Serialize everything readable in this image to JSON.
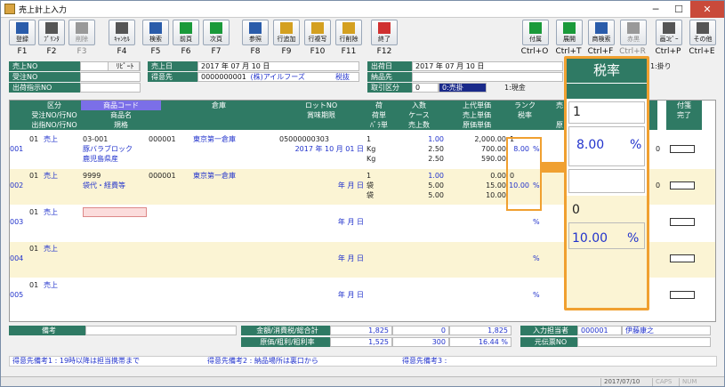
{
  "window": {
    "title": "売上計上入力",
    "min": "─",
    "max": "☐",
    "close": "✕"
  },
  "toolbar": {
    "left": [
      {
        "name": "register",
        "label": "登録",
        "icon": "save-icon",
        "key": "F1",
        "color": "#2a5caa",
        "disabled": false
      },
      {
        "name": "print",
        "label": "ﾌﾟﾘﾝﾀ",
        "icon": "printer-icon",
        "key": "F2",
        "color": "#555",
        "disabled": false
      },
      {
        "name": "delete",
        "label": "削除",
        "icon": "delete-icon",
        "key": "F3",
        "color": "#999",
        "disabled": true
      },
      {
        "name": "cancel",
        "label": "ｷｬﾝｾﾙ",
        "icon": "cancel-icon",
        "key": "F4",
        "color": "#555",
        "disabled": false
      },
      {
        "name": "search",
        "label": "検索",
        "icon": "search-icon",
        "key": "F5",
        "color": "#2a5caa",
        "disabled": false
      },
      {
        "name": "prev",
        "label": "前頁",
        "icon": "arrow-left-icon",
        "key": "F6",
        "color": "#1a9a3a",
        "disabled": false
      },
      {
        "name": "next",
        "label": "次頁",
        "icon": "arrow-right-icon",
        "key": "F7",
        "color": "#1a9a3a",
        "disabled": false
      },
      {
        "name": "reference",
        "label": "参照",
        "icon": "reference-icon",
        "key": "F8",
        "color": "#2a5caa",
        "disabled": false
      },
      {
        "name": "row-add",
        "label": "行追加",
        "icon": "row-add-icon",
        "key": "F9",
        "color": "#d4a020",
        "disabled": false
      },
      {
        "name": "row-copy",
        "label": "行複写",
        "icon": "row-copy-icon",
        "key": "F10",
        "color": "#d4a020",
        "disabled": false
      },
      {
        "name": "row-delete",
        "label": "行削除",
        "icon": "row-delete-icon",
        "key": "F11",
        "color": "#d4a020",
        "disabled": false
      },
      {
        "name": "exit",
        "label": "終了",
        "icon": "exit-icon",
        "key": "F12",
        "color": "#d03030",
        "disabled": false
      }
    ],
    "right": [
      {
        "name": "attach",
        "label": "付属",
        "icon": "attach-icon",
        "key": "Ctrl+O",
        "color": "#1a9a3a",
        "disabled": false
      },
      {
        "name": "expand",
        "label": "展開",
        "icon": "expand-icon",
        "key": "Ctrl+T",
        "color": "#1a9a3a",
        "disabled": false
      },
      {
        "name": "product-search",
        "label": "商検索",
        "icon": "search-icon",
        "key": "Ctrl+F",
        "color": "#2a5caa",
        "disabled": false
      },
      {
        "name": "red-black",
        "label": "赤黒",
        "icon": "red-black-icon",
        "key": "Ctrl+R",
        "color": "#999",
        "disabled": true
      },
      {
        "name": "screen-copy",
        "label": "画ｺﾋﾟｰ",
        "icon": "screen-copy-icon",
        "key": "Ctrl+P",
        "color": "#555",
        "disabled": false
      },
      {
        "name": "other",
        "label": "その他",
        "icon": "tools-icon",
        "key": "Ctrl+E",
        "color": "#555",
        "disabled": false
      }
    ]
  },
  "header": {
    "sales_no_label": "売上NO",
    "sales_no": "",
    "repeat_label": "ﾘﾋﾟｰﾄ",
    "sales_date_label": "売上日",
    "sales_date": "2017 年 07 月 10 日",
    "ship_date_label": "出荷日",
    "ship_date": "2017 年 07 月 10 日",
    "slip_type": "1:掛り",
    "receipt_no_label": "受注NO",
    "receipt_no": "",
    "customer_label": "得意先",
    "customer_code": "0000000001",
    "customer_name": "(株)アイルフーズ",
    "tax_mode": "税抜",
    "delivery_label": "納品先",
    "delivery": "",
    "ship_instr_label": "出荷指示NO",
    "ship_instr": "",
    "trade_label": "取引区分",
    "trade_code": "0",
    "trade_value": "0:売掛",
    "trade_cash": "1:現金"
  },
  "grid": {
    "headers1": [
      "区分",
      "商品コード",
      "倉庫",
      "ロットNO",
      "荷",
      "入数",
      "上代単価",
      "ランク",
      "売",
      "",
      "",
      "付箋"
    ],
    "headers2": [
      "受注NO/行NO",
      "商品名",
      "",
      "賞味期限",
      "荷単",
      "ケース",
      "売上単価",
      "税率",
      "",
      "",
      "",
      "完了"
    ],
    "headers3": [
      "出指NO/行NO",
      "規格",
      "",
      "",
      "ﾊﾞﾗ単",
      "売上数",
      "原価単価",
      "",
      "原",
      "",
      "",
      ""
    ],
    "rows": [
      {
        "no": "001",
        "div_code": "01",
        "div": "売上",
        "code": "03-001",
        "wh_code": "000001",
        "wh": "東京第一倉庫",
        "lot": "05000000303",
        "pack": "1",
        "qty": "1.00",
        "list_price": "2,000.00",
        "rank": "1",
        "name": "豚バラブロック",
        "expiry": "2017 年 10 月 01 日",
        "unit1": "Kg",
        "case": "2.50",
        "sale_price": "700.00",
        "tax": "8.00",
        "pct": "%",
        "spec": "鹿児島県産",
        "unit2": "Kg",
        "sale_qty": "2.50",
        "cost": "590.00",
        "right_qty": "0"
      },
      {
        "no": "002",
        "div_code": "01",
        "div": "売上",
        "code": "9999",
        "wh_code": "000001",
        "wh": "東京第一倉庫",
        "lot": "",
        "pack": "1",
        "qty": "1.00",
        "list_price": "0.00",
        "rank": "0",
        "name": "袋代・経費等",
        "expiry": "年 月 日",
        "unit1": "袋",
        "case": "5.00",
        "sale_price": "15.00",
        "tax": "10.00",
        "pct": "%",
        "spec": "",
        "unit2": "袋",
        "sale_qty": "5.00",
        "cost": "10.00",
        "right_qty": "0"
      },
      {
        "no": "003",
        "div_code": "01",
        "div": "売上",
        "code": "",
        "wh_code": "",
        "wh": "",
        "lot": "",
        "pack": "",
        "qty": "",
        "list_price": "",
        "rank": "",
        "name": "",
        "expiry": "年 月 日",
        "unit1": "",
        "case": "",
        "sale_price": "",
        "tax": "",
        "pct": "%",
        "spec": "",
        "unit2": "",
        "sale_qty": "",
        "cost": "",
        "right_qty": ""
      },
      {
        "no": "004",
        "div_code": "01",
        "div": "売上",
        "code": "",
        "wh_code": "",
        "wh": "",
        "lot": "",
        "pack": "",
        "qty": "",
        "list_price": "",
        "rank": "",
        "name": "",
        "expiry": "年 月 日",
        "unit1": "",
        "case": "",
        "sale_price": "",
        "tax": "",
        "pct": "%",
        "spec": "",
        "unit2": "",
        "sale_qty": "",
        "cost": "",
        "right_qty": ""
      },
      {
        "no": "005",
        "div_code": "01",
        "div": "売上",
        "code": "",
        "wh_code": "",
        "wh": "",
        "lot": "",
        "pack": "",
        "qty": "",
        "list_price": "",
        "rank": "",
        "name": "",
        "expiry": "年 月 日",
        "unit1": "",
        "case": "",
        "sale_price": "",
        "tax": "",
        "pct": "%",
        "spec": "",
        "unit2": "",
        "sale_qty": "",
        "cost": "",
        "right_qty": ""
      }
    ]
  },
  "footer": {
    "memo_label": "備考",
    "memo": "",
    "totals_label": "金額/消費税/総合計",
    "amount": "1,825",
    "tax": "0",
    "total": "1,825",
    "cost_label": "原価/粗利/粗利率",
    "cost": "1,525",
    "gross": "300",
    "gross_rate": "16.44 %",
    "staff_label": "入力担当者",
    "staff_code": "000001",
    "staff_name": "伊藤康之",
    "origin_label": "元伝票NO",
    "origin": "",
    "note1": "得意先備考1 : 19時以降は担当携帯まで",
    "note2": "得意先備考2 : 納品場所は裏口から",
    "note3": "得意先備考3 :"
  },
  "status": {
    "date": "2017/07/10",
    "caps": "CAPS",
    "num": "NUM"
  },
  "zoom": {
    "title": "税率",
    "rank1": "1",
    "tax1": "8.00",
    "pct": "%",
    "rank2": "0",
    "tax2": "10.00"
  }
}
